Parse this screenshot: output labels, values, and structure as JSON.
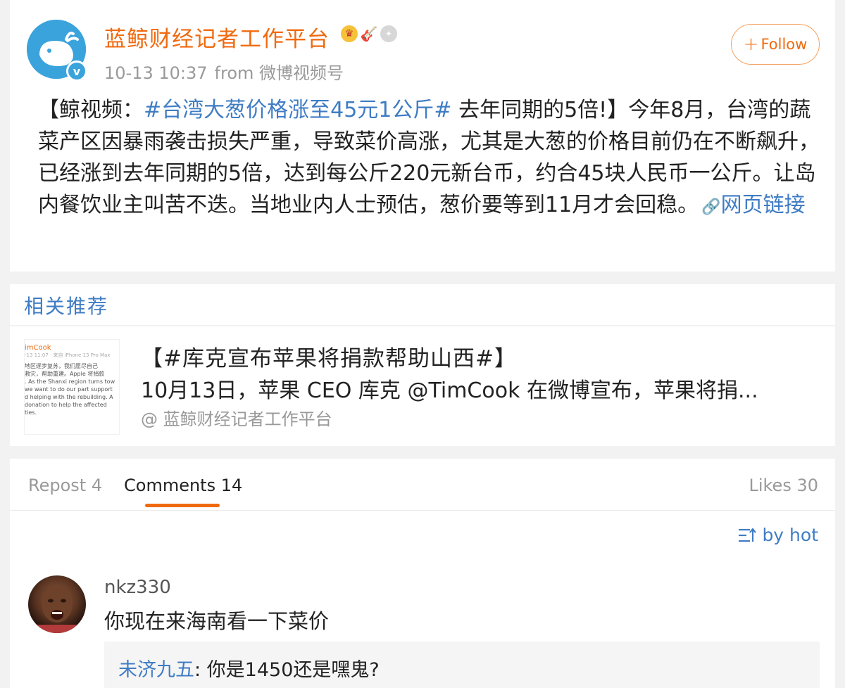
{
  "post": {
    "author": "蓝鲸财经记者工作平台",
    "time": "10-13 10:37",
    "source": "from 微博视频号",
    "follow_label": "Follow",
    "body_prefix": "【鲸视频：",
    "topic": "#台湾大葱价格涨至45元1公斤#",
    "body_text": " 去年同期的5倍!】今年8月，台湾的蔬菜产区因暴雨袭击损失严重，导致菜价高涨，尤其是大葱的价格目前仍在不断飙升，已经涨到去年同期的5倍，达到每公斤220元新台币，约合45块人民币一公斤。让岛内餐饮业主叫苦不迭。当地业内人士预估，葱价要等到11月才会回稳。",
    "link_label": "网页链接",
    "icons": [
      "avatar-whale-icon",
      "verified-icon",
      "crown-badge-icon",
      "guitar-badge-icon",
      "medal-badge-icon",
      "link-icon"
    ]
  },
  "related": {
    "header": "相关推荐",
    "title": "【#库克宣布苹果将捐款帮助山西#】",
    "snippet": "10月13日，苹果 CEO 库克 @TimCook 在微博宣布，苹果将捐...",
    "author": "@ 蓝鲸财经记者工作平台",
    "thumb": {
      "name": "imCook",
      "sub": "-13 11:07 · 来自 iPhone 13 Pro Max",
      "lines": [
        "地区逐步复苏，我们愿尽自己",
        "救灾，帮助重建。Apple 将捐款",
        ". As the Shanxi region turns tow",
        "we want to do our part support",
        "d helping with the rebuilding. A",
        "donation to help the affected",
        "ties."
      ]
    }
  },
  "comments": {
    "tabs": {
      "repost": "Repost 4",
      "comments": "Comments 14",
      "likes": "Likes 30"
    },
    "sort_label": "by hot",
    "items": [
      {
        "user": "nkz330",
        "text": "你现在来海南看一下菜价",
        "reply": {
          "user": "未济九五",
          "text": ": 你是1450还是嘿鬼?"
        }
      }
    ]
  }
}
